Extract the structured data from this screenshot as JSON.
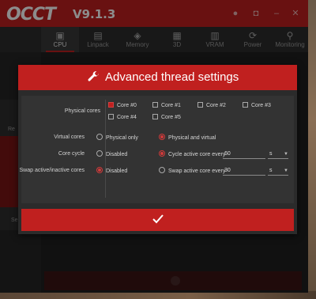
{
  "app": {
    "logo": "OCCT",
    "version": "V9.1.3"
  },
  "titlebar_icons": [
    "circle-icon",
    "camera-icon",
    "minimize-icon",
    "close-icon"
  ],
  "nav": {
    "items": [
      {
        "label": "CPU",
        "icon": "cpu-icon",
        "active": true
      },
      {
        "label": "Linpack",
        "icon": "linpack-icon",
        "active": false
      },
      {
        "label": "Memory",
        "icon": "memory-icon",
        "active": false
      },
      {
        "label": "3D",
        "icon": "3d-icon",
        "active": false
      },
      {
        "label": "VRAM",
        "icon": "vram-icon",
        "active": false
      },
      {
        "label": "Power",
        "icon": "power-icon",
        "active": false
      },
      {
        "label": "Monitoring",
        "icon": "monitoring-icon",
        "active": false
      }
    ]
  },
  "sidebar": {
    "partial_labels": [
      "Re",
      "Se"
    ]
  },
  "dialog": {
    "title": "Advanced thread settings",
    "title_icon": "wrench-icon",
    "physical_cores": {
      "label": "Physical cores",
      "cores": [
        {
          "label": "Core #0",
          "checked": true
        },
        {
          "label": "Core #1",
          "checked": false
        },
        {
          "label": "Core #2",
          "checked": false
        },
        {
          "label": "Core #3",
          "checked": false
        },
        {
          "label": "Core #4",
          "checked": false
        },
        {
          "label": "Core #5",
          "checked": false
        }
      ]
    },
    "virtual_cores": {
      "label": "Virtual cores",
      "option_physical_only": "Physical only",
      "option_physical_virtual": "Physical and virtual",
      "selected": "physical_virtual"
    },
    "core_cycle": {
      "label": "Core cycle",
      "option_disabled": "Disabled",
      "option_cycle": "Cycle active core every",
      "value": "60",
      "unit": "s",
      "selected": "cycle"
    },
    "swap": {
      "label": "Swap active/inactive cores",
      "option_disabled": "Disabled",
      "option_swap": "Swap active core every",
      "value": "30",
      "unit": "s",
      "selected": "disabled"
    },
    "ok_icon": "checkmark-icon"
  },
  "colors": {
    "accent": "#c0201f",
    "dialog_bg": "#2b2b2b",
    "panel_bg": "#333333"
  }
}
